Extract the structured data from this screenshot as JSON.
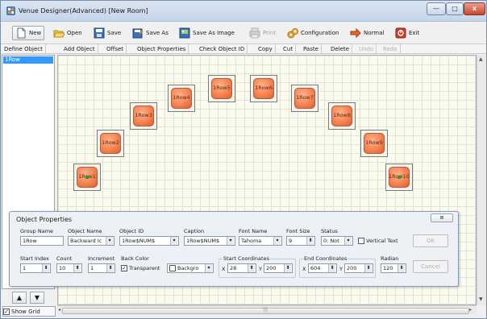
{
  "window": {
    "title": "Venue Designer(Advanced) [New Room]",
    "min_label": "—",
    "max_label": "□",
    "close_label": "x"
  },
  "toolbar": [
    {
      "label": "New",
      "icon": "new-doc-icon",
      "enabled": true
    },
    {
      "label": "Open",
      "icon": "folder-open-icon",
      "enabled": true
    },
    {
      "label": "Save",
      "icon": "save-icon",
      "enabled": true
    },
    {
      "label": "Save As",
      "icon": "save-as-icon",
      "enabled": true
    },
    {
      "label": "Save As Image",
      "icon": "save-image-icon",
      "enabled": true
    },
    {
      "label": "Print",
      "icon": "print-icon",
      "enabled": false
    },
    {
      "label": "Configuration",
      "icon": "configuration-icon",
      "enabled": true
    },
    {
      "label": "Normal",
      "icon": "arrow-right-icon",
      "enabled": true
    },
    {
      "label": "Exit",
      "icon": "exit-icon",
      "enabled": true
    }
  ],
  "commands": [
    {
      "label": "Define Object",
      "enabled": true
    },
    {
      "label": "Add Object",
      "enabled": true
    },
    {
      "label": "Offset",
      "enabled": true
    },
    {
      "label": "Object Properties",
      "enabled": true
    },
    {
      "label": "Check Object ID",
      "enabled": true
    },
    {
      "label": "Copy",
      "enabled": true
    },
    {
      "label": "Cut",
      "enabled": true
    },
    {
      "label": "Paste",
      "enabled": true
    },
    {
      "label": "Delete",
      "enabled": true
    },
    {
      "label": "Undo",
      "enabled": false
    },
    {
      "label": "Redo",
      "enabled": false
    }
  ],
  "object_list": {
    "selected": "1Row"
  },
  "nav": {
    "up": "▲",
    "down": "▼"
  },
  "show_grid": {
    "label": "Show Grid",
    "checked": true,
    "mark": "✓"
  },
  "scroll": {
    "up": "▲",
    "down": "▼",
    "left": "◂",
    "right": "▸",
    "grip": "|||"
  },
  "seats": [
    "1Row1",
    "1Row2",
    "1Row3",
    "1Row4",
    "1Row5",
    "1Row6",
    "1Row7",
    "1Row8",
    "1Row9",
    "1Row10"
  ],
  "selected_seats": [
    "1Row1",
    "1Row10"
  ],
  "properties": {
    "title": "Object Properties",
    "close_label": "⊠",
    "group_name_label": "Group Name",
    "group_name": "1Row",
    "object_name_label": "Object Name",
    "object_name": "Backward Ic",
    "object_id_label": "Object ID",
    "object_id": "1Row$NUM$",
    "caption_label": "Caption",
    "caption": "1Row$NUM$",
    "font_name_label": "Font Name",
    "font_name": "Tahoma",
    "font_size_label": "Font Size",
    "font_size": "9",
    "status_label": "Status",
    "status": "0: Not",
    "vertical_text_label": "Vertical Text",
    "ok_label": "OK",
    "cancel_label": "Cancel",
    "start_index_label": "Start Index",
    "start_index": "1",
    "count_label": "Count",
    "count": "10",
    "increment_label": "Increment",
    "increment": "1",
    "back_color_label": "Back Color",
    "transparent_label": "Transparent",
    "transparent_checked": true,
    "background_value": "Backgro",
    "start_coords_label": "Start Coordinates",
    "start_x_label": "X",
    "start_x": "28",
    "start_y_label": "Y",
    "start_y": "200",
    "end_coords_label": "End Coordinates",
    "end_x_label": "X",
    "end_x": "604",
    "end_y_label": "Y",
    "end_y": "200",
    "radian_label": "Radian",
    "radian": "120"
  },
  "colors": {
    "seat": "#f47f4d",
    "selection": "#3399ff",
    "grid_bg": "#fbfbf0"
  }
}
